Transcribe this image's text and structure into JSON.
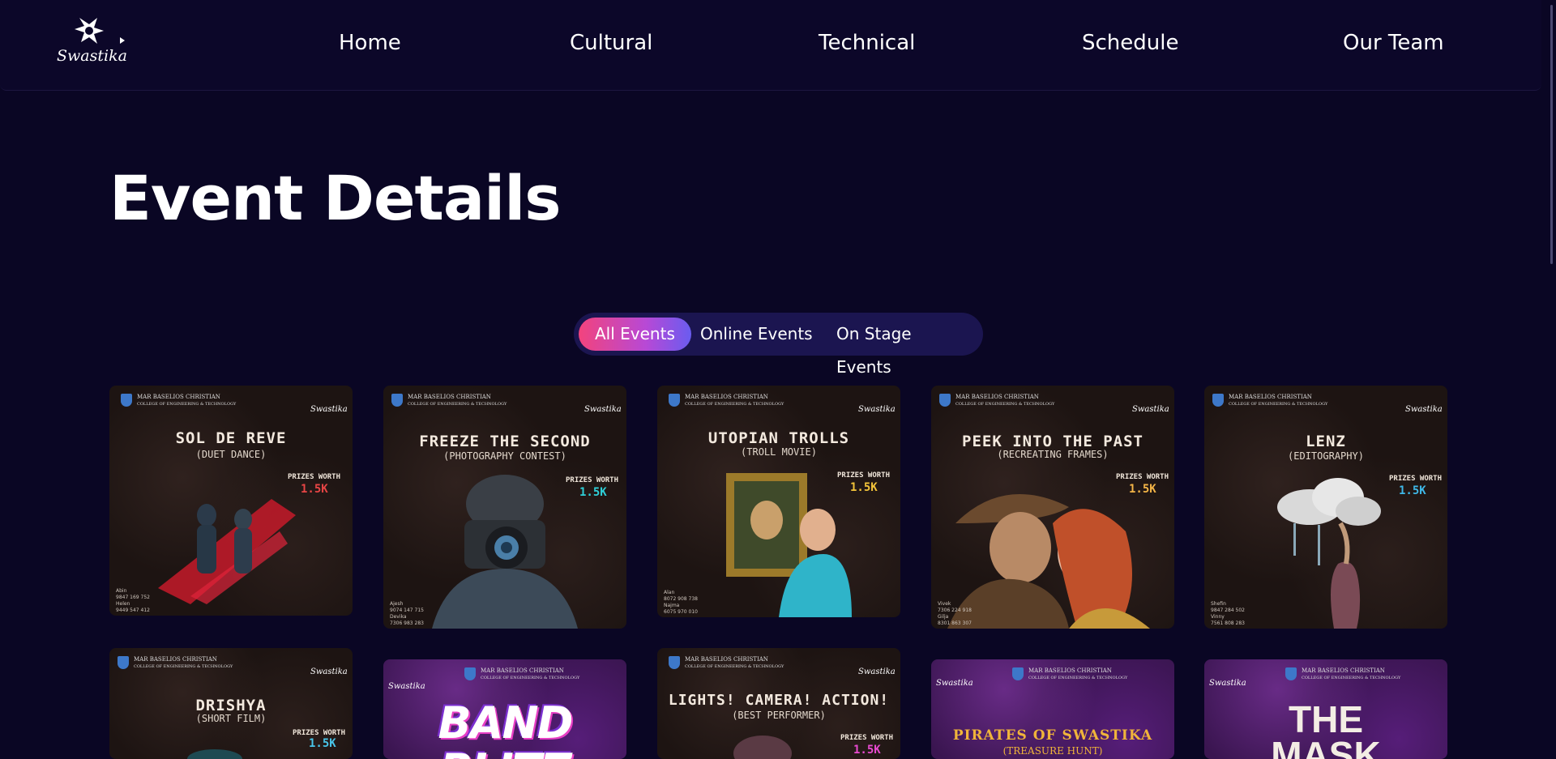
{
  "nav": {
    "logo_text": "Swastika",
    "links": [
      "Home",
      "Cultural",
      "Technical",
      "Schedule",
      "Our Team"
    ]
  },
  "page": {
    "title": "Event Details"
  },
  "filters": {
    "options": [
      "All Events",
      "Online Events",
      "On Stage Events"
    ],
    "selected": "All Events"
  },
  "college": {
    "line1": "MAR BASELIOS CHRISTIAN",
    "line2": "COLLEGE OF ENGINEERING & TECHNOLOGY"
  },
  "prize_label": "PRIZES WORTH",
  "cards": [
    {
      "title": "SOL DE REVE",
      "subtitle": "(DUET DANCE)",
      "prize": "1.5K",
      "prize_color": "#e84545",
      "contacts": [
        "Abin",
        "9847 169 752",
        "Helen",
        "9449 547 412"
      ]
    },
    {
      "title": "FREEZE THE SECOND",
      "subtitle": "(PHOTOGRAPHY CONTEST)",
      "prize": "1.5K",
      "prize_color": "#2fd0d8",
      "contacts": [
        "Ajesh",
        "9074 147 715",
        "Devika",
        "7306 983 283"
      ]
    },
    {
      "title": "UTOPIAN TROLLS",
      "subtitle": "(TROLL MOVIE)",
      "prize": "1.5K",
      "prize_color": "#f3c43a",
      "contacts": [
        "Alan",
        "8072 908 738",
        "Najma",
        "6075 970 010"
      ]
    },
    {
      "title": "PEEK INTO THE PAST",
      "subtitle": "(RECREATING FRAMES)",
      "prize": "1.5K",
      "prize_color": "#f4b547",
      "contacts": [
        "Vivek",
        "7306 224 918",
        "Gilja",
        "8301 863 307"
      ]
    },
    {
      "title": "LENZ",
      "subtitle": "(EDITOGRAPHY)",
      "prize": "1.5K",
      "prize_color": "#3fb8e8",
      "contacts": [
        "Shefin",
        "9847 284 502",
        "Vinny",
        "7561 808 283"
      ]
    },
    {
      "title": "DRISHYA",
      "subtitle": "(SHORT FILM)",
      "prize": "1.5K",
      "prize_color": "#49c6ea"
    },
    {
      "title": "BAND BLITZ",
      "subtitle": ""
    },
    {
      "title": "LIGHTS! CAMERA! ACTION!",
      "subtitle": "(BEST PERFORMER)",
      "prize": "1.5K",
      "prize_color": "#e94bd1"
    },
    {
      "title": "PIRATES OF SWASTIKA",
      "subtitle": "(TREASURE HUNT)"
    },
    {
      "title": "THE MASK",
      "subtitle": ""
    }
  ],
  "colors": {
    "background": "#0a0624",
    "filter_bar": "#1b1550",
    "active_gradient_start": "#f2437d",
    "active_gradient_end": "#6a5cf0"
  }
}
